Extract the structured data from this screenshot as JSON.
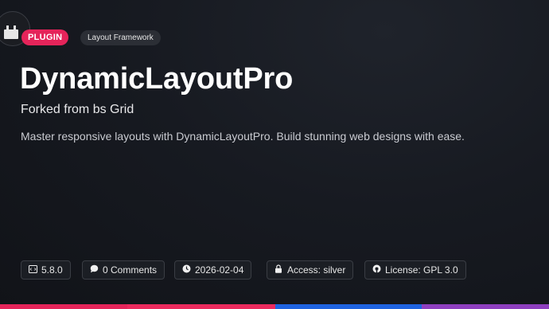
{
  "header": {
    "plugin_badge": "PLUGIN",
    "category": "Layout Framework",
    "title": "DynamicLayoutPro",
    "subtitle": "Forked from bs Grid",
    "description": "Master responsive layouts with DynamicLayoutPro. Build stunning web designs with ease."
  },
  "meta": {
    "version": "5.8.0",
    "comments": "0 Comments",
    "date": "2026-02-04",
    "access": "Access: silver",
    "license": "License: GPL 3.0"
  },
  "icons": {
    "logo": "plug-icon",
    "version": "code-icon",
    "comments": "comment-icon",
    "date": "clock-icon",
    "access": "lock-icon",
    "license": "license-icon"
  },
  "colors": {
    "plugin_badge": "#e5245a",
    "bar": [
      "#e5245a",
      "#ec2a5e",
      "#1e63e0",
      "#8f3fc0"
    ]
  }
}
